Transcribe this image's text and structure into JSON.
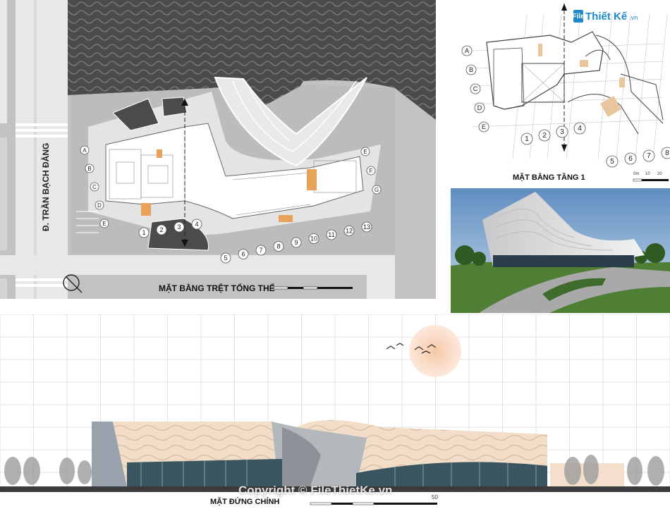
{
  "site_plan": {
    "caption": "MẶT BẰNG TRỆT TỔNG THỂ",
    "road_label": "Đ. TRẦN BẠCH ĐẰNG",
    "axis_letters": [
      "A",
      "B",
      "C",
      "D",
      "E"
    ],
    "axis_letters_right": [
      "E",
      "F",
      "G"
    ],
    "axis_numbers": [
      "1",
      "2",
      "3",
      "4",
      "5",
      "6",
      "7",
      "8",
      "9",
      "10",
      "11",
      "12",
      "13"
    ]
  },
  "floor1": {
    "caption": "MẶT BẰNG TẦNG 1",
    "axis_letters": [
      "A",
      "B",
      "C",
      "D",
      "E"
    ],
    "axis_numbers": [
      "1",
      "2",
      "3",
      "4",
      "5",
      "6",
      "7",
      "8"
    ],
    "scale_labels": [
      "0m",
      "10",
      "20"
    ]
  },
  "elevation": {
    "caption": "MẶT ĐỨNG CHÍNH",
    "scale_end": "50"
  },
  "watermark": {
    "logo_box": "File",
    "logo_text": "Thiết Kế",
    "logo_domain": ".vn",
    "copyright": "Copyright © FileThietKe.vn"
  },
  "colors": {
    "water": "#4a4a4a",
    "road": "#e6e6e6",
    "ground": "#bdbdbd",
    "building": "#ffffff",
    "accent_orange": "#e8a25a",
    "facade": "#f1ddc8",
    "sky": "#7fa7cf",
    "grass": "#5b8f3a",
    "brand_blue": "#1e88c8"
  }
}
